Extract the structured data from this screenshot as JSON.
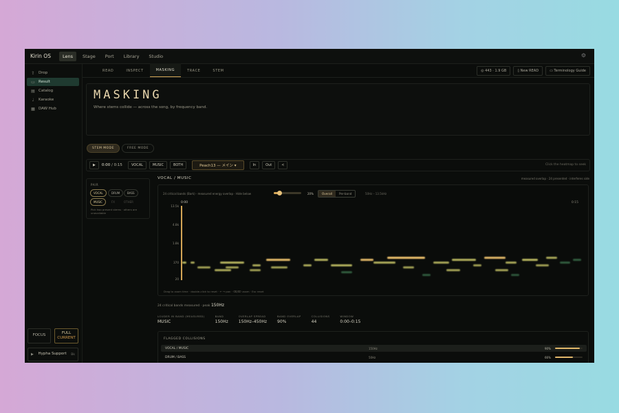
{
  "app": {
    "name": "Kirin OS",
    "tabs": [
      "Lens",
      "Stage",
      "Port",
      "Library",
      "Studio"
    ],
    "active_tab": "Lens"
  },
  "sidebar": {
    "items": [
      {
        "label": "Drop",
        "icon": "upload-icon"
      },
      {
        "label": "Result",
        "icon": "folder-icon"
      },
      {
        "label": "Catalog",
        "icon": "catalog-icon"
      },
      {
        "label": "Karaoke",
        "icon": "microphone-icon"
      },
      {
        "label": "DAW Hub",
        "icon": "grid-icon"
      }
    ],
    "active_index": 1,
    "focus_label": "FOCUS",
    "full_label": "FULL",
    "full_sub": "CURRENT",
    "hypha_label": "Hypha Support",
    "hypha_shortcut": "Bk"
  },
  "subnav": {
    "tabs": [
      "READ",
      "INSPECT",
      "MASKING",
      "TRACE",
      "STEM"
    ],
    "active": "MASKING",
    "info": "◎ 443 · 1.9 GB",
    "new_read": "New READ",
    "guide": "Terminology Guide"
  },
  "hero": {
    "title": "MASKING",
    "subtitle": "Where stems collide — across the song, by frequency band."
  },
  "modes": {
    "stem": "STEM MODE",
    "free": "FREE MODE",
    "active": "STEM MODE"
  },
  "transport": {
    "play": "▶",
    "current": "0:00",
    "total": "0:15",
    "buttons": [
      "VOCAL",
      "MUSIC",
      "BOTH"
    ],
    "song": "Peach13 — メイン ▾",
    "in_label": "In",
    "out_label": "Out",
    "back": "<",
    "hint": "Click the heatmap to seek"
  },
  "pair": {
    "title": "PAIR",
    "row1": [
      "VOCAL",
      "DRUM",
      "BASS"
    ],
    "row2": [
      "MUSIC",
      "FX",
      "OTHER"
    ],
    "selected": [
      "VOCAL",
      "MUSIC"
    ],
    "disabled": [
      "FX",
      "OTHER"
    ],
    "note": "Pick two present stems · others are unavailable"
  },
  "heatmap": {
    "heading": "VOCAL / MUSIC",
    "legend": "measured overlap · 24 presented · interferes side",
    "info": "24 critical bands (Bark) · measured energy overlap · Hide below",
    "threshold_pct": 20,
    "threshold_label": "20%",
    "view_options": [
      "Overall",
      "Per-band"
    ],
    "view_active": "Overall",
    "range": "50Hz – 13.5kHz",
    "time_start": "0:00",
    "time_end": "0:15",
    "y_ticks": [
      "13.5k",
      "4.8k",
      "1.8k",
      "370",
      "20"
    ],
    "help": "Drag to zoom time · double-click to reset · ← → pan · ⌫/⌦ zoom · Esc reset"
  },
  "chart_data": {
    "type": "heatmap",
    "x_range_sec": [
      0,
      15
    ],
    "y_ticks_hz": [
      "13.5k",
      "4.8k",
      "1.8k",
      "370",
      "20"
    ],
    "cells": [
      {
        "t": 0.0,
        "dur": 0.15,
        "band": 5,
        "v": 0.8
      },
      {
        "t": 0.3,
        "dur": 0.15,
        "band": 5,
        "v": 0.7
      },
      {
        "t": 0.55,
        "dur": 0.5,
        "band": 3,
        "v": 0.6
      },
      {
        "t": 1.2,
        "dur": 0.6,
        "band": 2,
        "v": 0.7
      },
      {
        "t": 1.4,
        "dur": 0.9,
        "band": 5,
        "v": 0.8
      },
      {
        "t": 1.6,
        "dur": 0.5,
        "band": 3,
        "v": 0.6
      },
      {
        "t": 2.5,
        "dur": 0.4,
        "band": 2,
        "v": 0.6
      },
      {
        "t": 2.6,
        "dur": 0.3,
        "band": 4,
        "v": 0.7
      },
      {
        "t": 3.1,
        "dur": 0.9,
        "band": 6,
        "v": 0.95
      },
      {
        "t": 3.3,
        "dur": 0.6,
        "band": 3,
        "v": 0.6
      },
      {
        "t": 4.5,
        "dur": 0.3,
        "band": 4,
        "v": 0.7
      },
      {
        "t": 4.9,
        "dur": 0.5,
        "band": 6,
        "v": 0.8
      },
      {
        "t": 5.5,
        "dur": 0.8,
        "band": 4,
        "v": 0.8
      },
      {
        "t": 5.9,
        "dur": 0.4,
        "band": 1,
        "v": 0.5
      },
      {
        "t": 6.6,
        "dur": 0.5,
        "band": 6,
        "v": 0.9
      },
      {
        "t": 7.1,
        "dur": 0.8,
        "band": 5,
        "v": 0.75
      },
      {
        "t": 7.6,
        "dur": 1.4,
        "band": 7,
        "v": 1.0
      },
      {
        "t": 8.2,
        "dur": 0.4,
        "band": 3,
        "v": 0.6
      },
      {
        "t": 8.9,
        "dur": 0.3,
        "band": 0,
        "v": 0.45
      },
      {
        "t": 9.3,
        "dur": 0.6,
        "band": 5,
        "v": 0.7
      },
      {
        "t": 9.8,
        "dur": 0.5,
        "band": 2,
        "v": 0.65
      },
      {
        "t": 10.0,
        "dur": 0.9,
        "band": 6,
        "v": 0.8
      },
      {
        "t": 10.8,
        "dur": 0.3,
        "band": 4,
        "v": 0.6
      },
      {
        "t": 11.2,
        "dur": 0.8,
        "band": 7,
        "v": 0.9
      },
      {
        "t": 11.6,
        "dur": 0.5,
        "band": 2,
        "v": 0.65
      },
      {
        "t": 12.0,
        "dur": 0.4,
        "band": 5,
        "v": 0.7
      },
      {
        "t": 12.2,
        "dur": 0.3,
        "band": 0,
        "v": 0.4
      },
      {
        "t": 12.6,
        "dur": 0.6,
        "band": 6,
        "v": 0.85
      },
      {
        "t": 13.1,
        "dur": 0.5,
        "band": 4,
        "v": 0.6
      },
      {
        "t": 13.5,
        "dur": 0.4,
        "band": 7,
        "v": 0.7
      },
      {
        "t": 14.0,
        "dur": 0.4,
        "band": 5,
        "v": 0.5
      },
      {
        "t": 14.5,
        "dur": 0.3,
        "band": 6,
        "v": 0.5
      }
    ],
    "colors": {
      "low": "#3f7a52",
      "mid": "#c9c768",
      "high": "#f0c46e"
    }
  },
  "summary": {
    "text": "24 critical bands measured · peak",
    "peak": "150Hz"
  },
  "stats": [
    {
      "label": "LOUDER IN BAND (MEASURED)",
      "value": "MUSIC"
    },
    {
      "label": "BAND",
      "value": "150Hz"
    },
    {
      "label": "OVERLAP SPREAD",
      "value": "150Hz–450Hz"
    },
    {
      "label": "BAND OVERLAP",
      "value": "90%"
    },
    {
      "label": "COLLISIONS",
      "value": "44"
    },
    {
      "label": "WINDOW",
      "value": "0:00–0:15"
    }
  ],
  "collisions": {
    "title": "FLAGGED COLLISIONS",
    "rows": [
      {
        "pair": "VOCAL / MUSIC",
        "band": "150Hz",
        "pct": "90%",
        "fill": 0.9
      },
      {
        "pair": "DRUM / BASS",
        "band": "50Hz",
        "pct": "66%",
        "fill": 0.66
      }
    ]
  }
}
